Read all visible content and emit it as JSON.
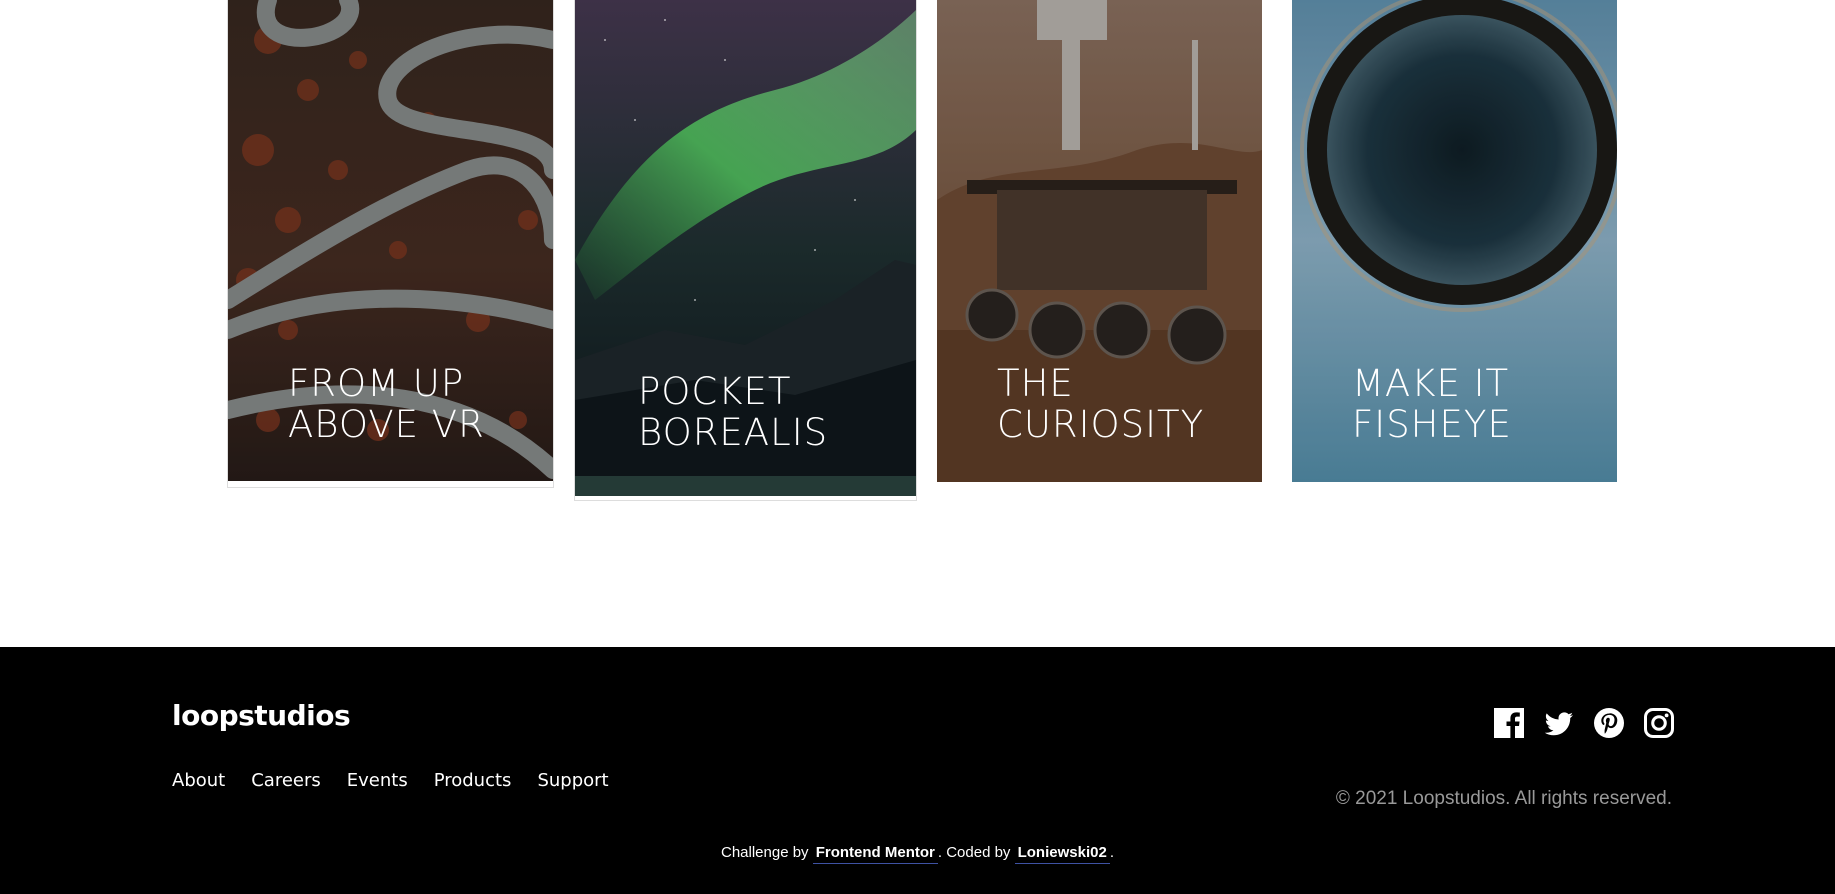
{
  "gallery": {
    "cards": [
      {
        "line1": "From up",
        "line2": "above VR",
        "image": "aerial-winding-roads-forest"
      },
      {
        "line1": "Pocket",
        "line2": "borealis",
        "image": "aurora-borealis-night-sky"
      },
      {
        "line1": "The",
        "line2": "curiosity",
        "image": "mars-rover"
      },
      {
        "line1": "Make it",
        "line2": "fisheye",
        "image": "fisheye-tiny-planet"
      }
    ]
  },
  "footer": {
    "logo": "loopstudios",
    "nav": [
      "About",
      "Careers",
      "Events",
      "Products",
      "Support"
    ],
    "social_icons": [
      "facebook-icon",
      "twitter-icon",
      "pinterest-icon",
      "instagram-icon"
    ],
    "copyright": "© 2021 Loopstudios. All rights reserved.",
    "attribution": {
      "prefix": "Challenge by",
      "challenge_link": "Frontend Mentor",
      "middle": ". Coded by",
      "author_link": "Loniewski02",
      "suffix": "."
    }
  },
  "colors": {
    "footer_bg": "#000000",
    "copyright_text": "#999999",
    "link_underline": "#3e52a3"
  }
}
